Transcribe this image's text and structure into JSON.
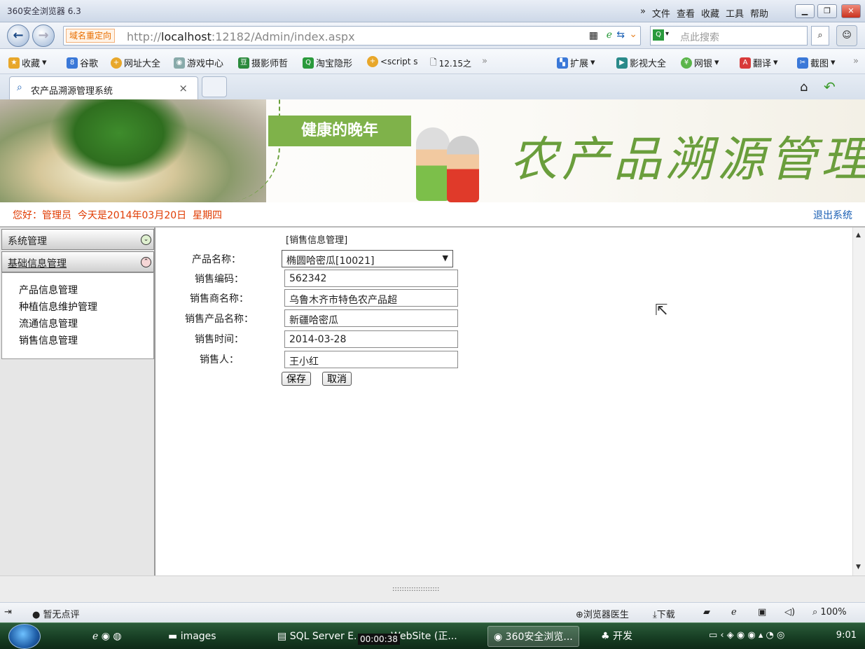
{
  "browser": {
    "title": "360安全浏览器 6.3",
    "menu": [
      "»",
      "文件",
      "查看",
      "收藏",
      "工具",
      "帮助"
    ],
    "address": {
      "redirect_label": "域名重定向",
      "url_prefix": "http://",
      "url_host": "localhost",
      "url_rest": ":12182/Admin/index.aspx"
    },
    "search_placeholder": "点此搜索",
    "bookmarks": [
      "收藏",
      "谷歌",
      "网址大全",
      "游戏中心",
      "摄影师哲",
      "淘宝隐形",
      "<script s",
      "12.15之",
      "»"
    ],
    "bookmarks_right": [
      "扩展",
      "影视大全",
      "网银",
      "翻译",
      "截图",
      "»"
    ],
    "tab": {
      "label": "农产品溯源管理系统",
      "close": "×"
    }
  },
  "banner": {
    "slogan": "健康的晚年",
    "calligraphy": "农产品溯源管理"
  },
  "greeting": {
    "text": "您好：管理员  今天是2014年03月20日  星期四",
    "logout": "退出系统"
  },
  "sidebar": {
    "sections": [
      {
        "label": "系统管理"
      },
      {
        "label": "基础信息管理"
      }
    ],
    "items": [
      "产品信息管理",
      "种植信息维护管理",
      "流通信息管理",
      "销售信息管理"
    ]
  },
  "form": {
    "heading": "[销售信息管理]",
    "labels": {
      "product": "产品名称：",
      "code": "销售编码：",
      "seller": "销售商名称：",
      "sale_product": "销售产品名称：",
      "time": "销售时间：",
      "person": "销售人："
    },
    "values": {
      "product": "椭圆哈密瓜[10021]",
      "code": "562342",
      "seller": "乌鲁木齐市特色农产品超",
      "sale_product": "新疆哈密瓜",
      "time": "2014-03-28",
      "person": "王小红"
    },
    "save": "保存",
    "cancel": "取消"
  },
  "splitter_dots": "::::::::::::::::::::",
  "status": {
    "rating": "暂无点评",
    "doctor": "浏览器医生",
    "download": "下载",
    "zoom": "100%"
  },
  "taskbar": {
    "items": [
      "images",
      "SQL Server E...",
      "WebSite (正...",
      "360安全浏览...",
      "开发"
    ],
    "recording": "00:00:38",
    "clock": "9:01"
  }
}
